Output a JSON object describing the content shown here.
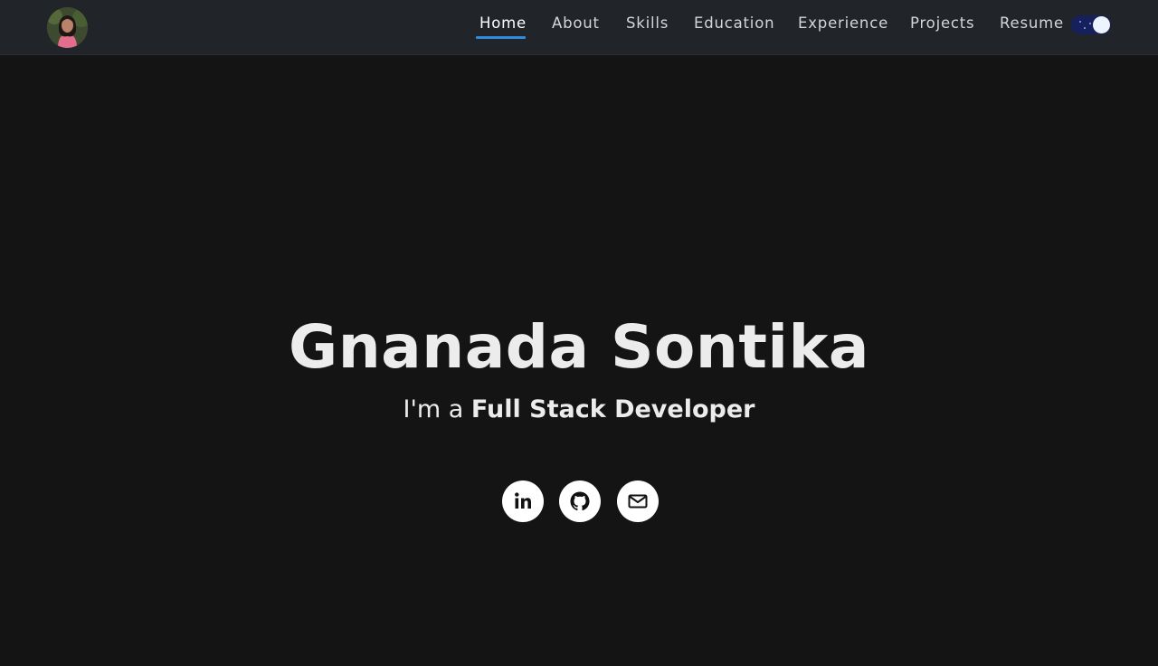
{
  "nav": {
    "links": [
      {
        "label": "Home",
        "active": true
      },
      {
        "label": "About",
        "active": false
      },
      {
        "label": "Skills",
        "active": false
      },
      {
        "label": "Education",
        "active": false
      },
      {
        "label": "Experience",
        "active": false
      },
      {
        "label": "Projects",
        "active": false
      },
      {
        "label": "Resume",
        "active": false
      }
    ],
    "accent_color": "#2f8be0",
    "theme_toggle": {
      "state": "dark",
      "icon": "moon-toggle-icon"
    }
  },
  "hero": {
    "name": "Gnanada Sontika",
    "role_prefix": "I'm a ",
    "role": "Full Stack Developer"
  },
  "social": [
    {
      "icon": "linkedin-icon"
    },
    {
      "icon": "github-icon"
    },
    {
      "icon": "mail-icon"
    }
  ],
  "colors": {
    "background": "#141415",
    "navbar": "#212429",
    "text": "#ececec"
  }
}
